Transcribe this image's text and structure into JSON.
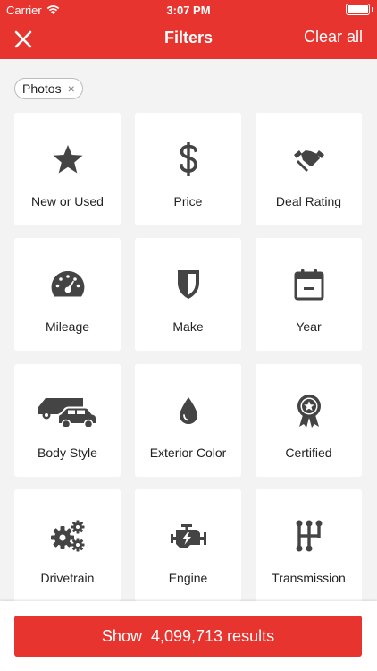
{
  "status_bar": {
    "carrier": "Carrier",
    "time": "3:07 PM"
  },
  "header": {
    "title": "Filters",
    "clear_all": "Clear all",
    "close_icon": "close-icon"
  },
  "active_filters": [
    {
      "label": "Photos",
      "remove_icon": "×"
    }
  ],
  "filter_tiles": [
    {
      "label": "New or Used",
      "icon": "star-icon"
    },
    {
      "label": "Price",
      "icon": "dollar-icon"
    },
    {
      "label": "Deal Rating",
      "icon": "handshake-icon"
    },
    {
      "label": "Mileage",
      "icon": "speedometer-icon"
    },
    {
      "label": "Make",
      "icon": "shield-icon"
    },
    {
      "label": "Year",
      "icon": "calendar-icon"
    },
    {
      "label": "Body Style",
      "icon": "car-truck-icon"
    },
    {
      "label": "Exterior Color",
      "icon": "paint-drop-icon"
    },
    {
      "label": "Certified",
      "icon": "award-ribbon-icon"
    },
    {
      "label": "Drivetrain",
      "icon": "gears-icon"
    },
    {
      "label": "Engine",
      "icon": "engine-icon"
    },
    {
      "label": "Transmission",
      "icon": "gear-shift-icon"
    }
  ],
  "footer": {
    "show_label": "Show",
    "results_count": "4,099,713",
    "results_label": "results"
  },
  "colors": {
    "accent": "#e8342e",
    "background": "#f3f3f3",
    "icon": "#444444"
  }
}
